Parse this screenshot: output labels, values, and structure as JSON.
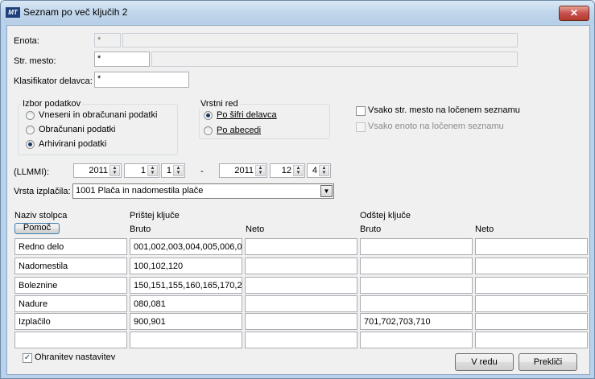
{
  "window": {
    "title": "Seznam po več ključih  2",
    "app_icon": "MT",
    "close": "✕"
  },
  "fields": {
    "enota": {
      "label": "Enota:",
      "value": "*",
      "extra": ""
    },
    "str_mesto": {
      "label": "Str. mesto:",
      "value": "*",
      "extra": ""
    },
    "klasifikator": {
      "label": "Klasifikator delavca:",
      "value": "*"
    }
  },
  "izbor": {
    "title": "Izbor podatkov",
    "options": [
      "Vneseni in obračunani podatki",
      "Obračunani podatki",
      "Arhivirani podatki"
    ],
    "selected": 2
  },
  "vrstni_red": {
    "title": "Vrstni red",
    "options": [
      "Po šifri delavca",
      "Po abecedi"
    ],
    "selected": 0
  },
  "checkboxes": [
    {
      "label": "Vsako str. mesto na ločenem seznamu",
      "checked": false,
      "enabled": true
    },
    {
      "label": "Vsako enoto na ločenem seznamu",
      "checked": false,
      "enabled": false
    }
  ],
  "period": {
    "label": "(LLMMI):",
    "from": [
      "2011",
      "1",
      "1"
    ],
    "separator": "-",
    "to": [
      "2011",
      "12",
      "4"
    ]
  },
  "vrsta": {
    "label": "Vrsta izplačila:",
    "value": "1001  Plača in nadomestila plače"
  },
  "columns": {
    "naziv": "Naziv stolpca",
    "pristej": "Prištej ključe",
    "odstej": "Odštej ključe",
    "bruto": "Bruto",
    "neto": "Neto",
    "pomoc": "Pomoč"
  },
  "rows": [
    [
      "Redno delo",
      "001,002,003,004,005,006,0",
      "",
      "",
      ""
    ],
    [
      "Nadomestila",
      "100,102,120",
      "",
      "",
      ""
    ],
    [
      "Boleznine",
      "150,151,155,160,165,170,2",
      "",
      "",
      ""
    ],
    [
      "Nadure",
      "080,081",
      "",
      "",
      ""
    ],
    [
      "Izplačilo",
      "900,901",
      "",
      "701,702,703,710",
      ""
    ],
    [
      "",
      "",
      "",
      "",
      ""
    ]
  ],
  "ohranitev": {
    "label": "Ohranitev nastavitev",
    "checked": true
  },
  "buttons": {
    "ok": "V redu",
    "cancel": "Prekliči"
  },
  "icons": {
    "up": "▲",
    "down": "▼",
    "check": "✓"
  }
}
